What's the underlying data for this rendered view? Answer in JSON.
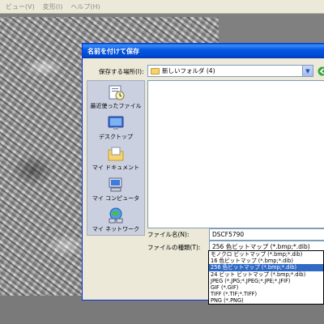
{
  "menubar": {
    "items": [
      "ビュー(V)",
      "変形(I)",
      "ヘルプ(H)"
    ]
  },
  "dialog": {
    "title": "名前を付けて保存",
    "save_in_label": "保存する場所(I):",
    "save_in_value": "新しいフォルダ (4)",
    "places": [
      {
        "label": "最近使ったファイル",
        "icon": "recent-files-icon"
      },
      {
        "label": "デスクトップ",
        "icon": "desktop-icon"
      },
      {
        "label": "マイ ドキュメント",
        "icon": "my-documents-icon"
      },
      {
        "label": "マイ コンピュータ",
        "icon": "my-computer-icon"
      },
      {
        "label": "マイ ネットワーク",
        "icon": "my-network-icon"
      }
    ],
    "filename_label": "ファイル名(N):",
    "filename_value": "DSCF5790",
    "filetype_label": "ファイルの種類(T):",
    "filetype_value": "256 色ビットマップ (*.bmp;*.dib)",
    "filetype_options": [
      "モノクロ ビットマップ (*.bmp;*.dib)",
      "16 色ビットマップ (*.bmp;*.dib)",
      "256 色ビットマップ (*.bmp;*.dib)",
      "24 ビット ビットマップ (*.bmp;*.dib)",
      "JPEG (*.JPG;*.JPEG;*.JPE;*.JFIF)",
      "GIF (*.GIF)",
      "TIFF (*.TIF;*.TIFF)",
      "PNG (*.PNG)"
    ],
    "selected_option_index": 2
  },
  "colors": {
    "titlebar": "#0558e2",
    "dialog_bg": "#ece9d8",
    "selection": "#316ac5"
  }
}
